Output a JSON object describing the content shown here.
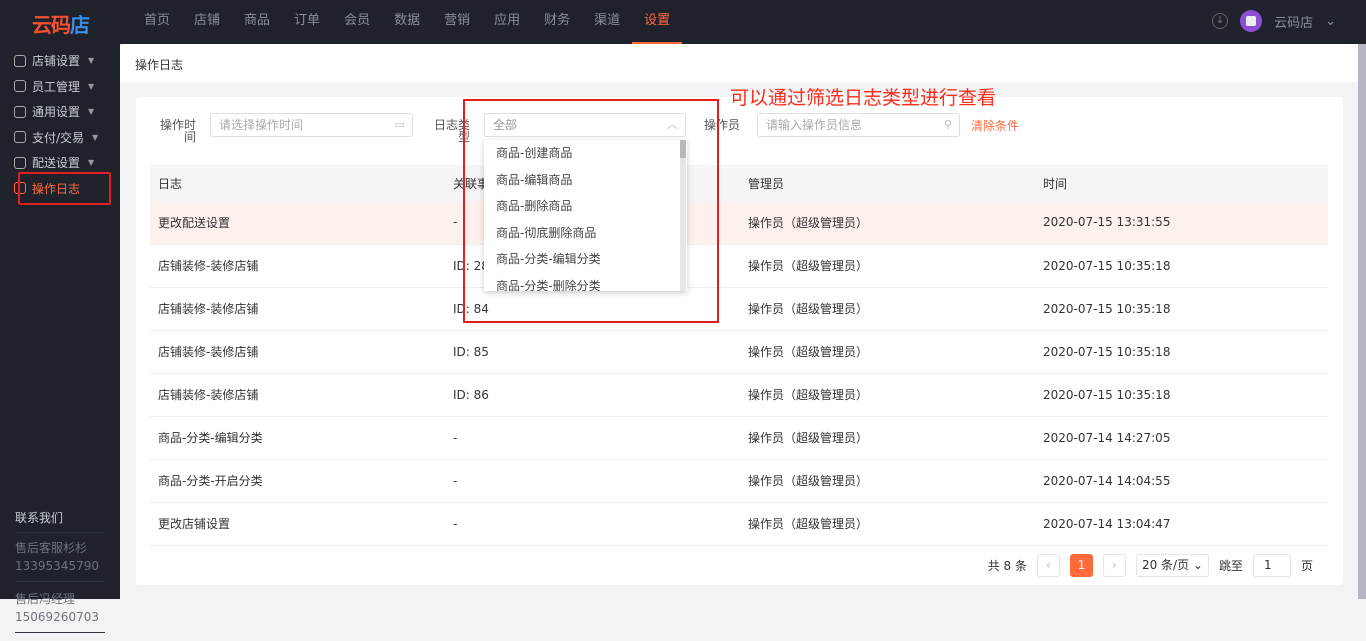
{
  "logo": {
    "text_a": "云码",
    "text_b": "店"
  },
  "nav": [
    "首页",
    "店铺",
    "商品",
    "订单",
    "会员",
    "数据",
    "营销",
    "应用",
    "财务",
    "渠道",
    "设置"
  ],
  "nav_active": "设置",
  "user": {
    "name": "云码店"
  },
  "sidebar": [
    {
      "label": "店铺设置"
    },
    {
      "label": "员工管理"
    },
    {
      "label": "通用设置"
    },
    {
      "label": "支付/交易"
    },
    {
      "label": "配送设置"
    },
    {
      "label": "操作日志"
    }
  ],
  "contact": {
    "title": "联系我们",
    "items": [
      {
        "name": "售后客服杉杉",
        "phone": "13395345790"
      },
      {
        "name": "售后冯经理",
        "phone": "15069260703"
      }
    ]
  },
  "page_title": "操作日志",
  "filters": {
    "time_label": "操作时间",
    "time_placeholder": "请选择操作时间",
    "type_label": "日志类型",
    "type_value": "全部",
    "operator_label": "操作员",
    "operator_placeholder": "请输入操作员信息",
    "clear": "清除条件"
  },
  "dropdown": [
    "商品-创建商品",
    "商品-编辑商品",
    "商品-删除商品",
    "商品-彻底删除商品",
    "商品-分类-编辑分类",
    "商品-分类-删除分类"
  ],
  "table": {
    "headers": [
      "日志",
      "关联事项",
      "管理员",
      "时间"
    ],
    "rows": [
      [
        "更改配送设置",
        "-",
        "操作员（超级管理员）",
        "2020-07-15 13:31:55"
      ],
      [
        "店铺装修-装修店铺",
        "ID: 28",
        "操作员（超级管理员）",
        "2020-07-15 10:35:18"
      ],
      [
        "店铺装修-装修店铺",
        "ID: 84",
        "操作员（超级管理员）",
        "2020-07-15 10:35:18"
      ],
      [
        "店铺装修-装修店铺",
        "ID: 85",
        "操作员（超级管理员）",
        "2020-07-15 10:35:18"
      ],
      [
        "店铺装修-装修店铺",
        "ID: 86",
        "操作员（超级管理员）",
        "2020-07-15 10:35:18"
      ],
      [
        "商品-分类-编辑分类",
        "-",
        "操作员（超级管理员）",
        "2020-07-14 14:27:05"
      ],
      [
        "商品-分类-开启分类",
        "-",
        "操作员（超级管理员）",
        "2020-07-14 14:04:55"
      ],
      [
        "更改店铺设置",
        "-",
        "操作员（超级管理员）",
        "2020-07-14 13:04:47"
      ]
    ]
  },
  "pager": {
    "total": "共 8 条",
    "current": "1",
    "size": "20 条/页",
    "goto": "跳至",
    "goto_value": "1",
    "page_unit": "页"
  },
  "annotation": "可以通过筛选日志类型进行查看",
  "colors": {
    "accent": "#ff6a3d",
    "annotation": "#e02020",
    "topbar": "#1f222b"
  }
}
